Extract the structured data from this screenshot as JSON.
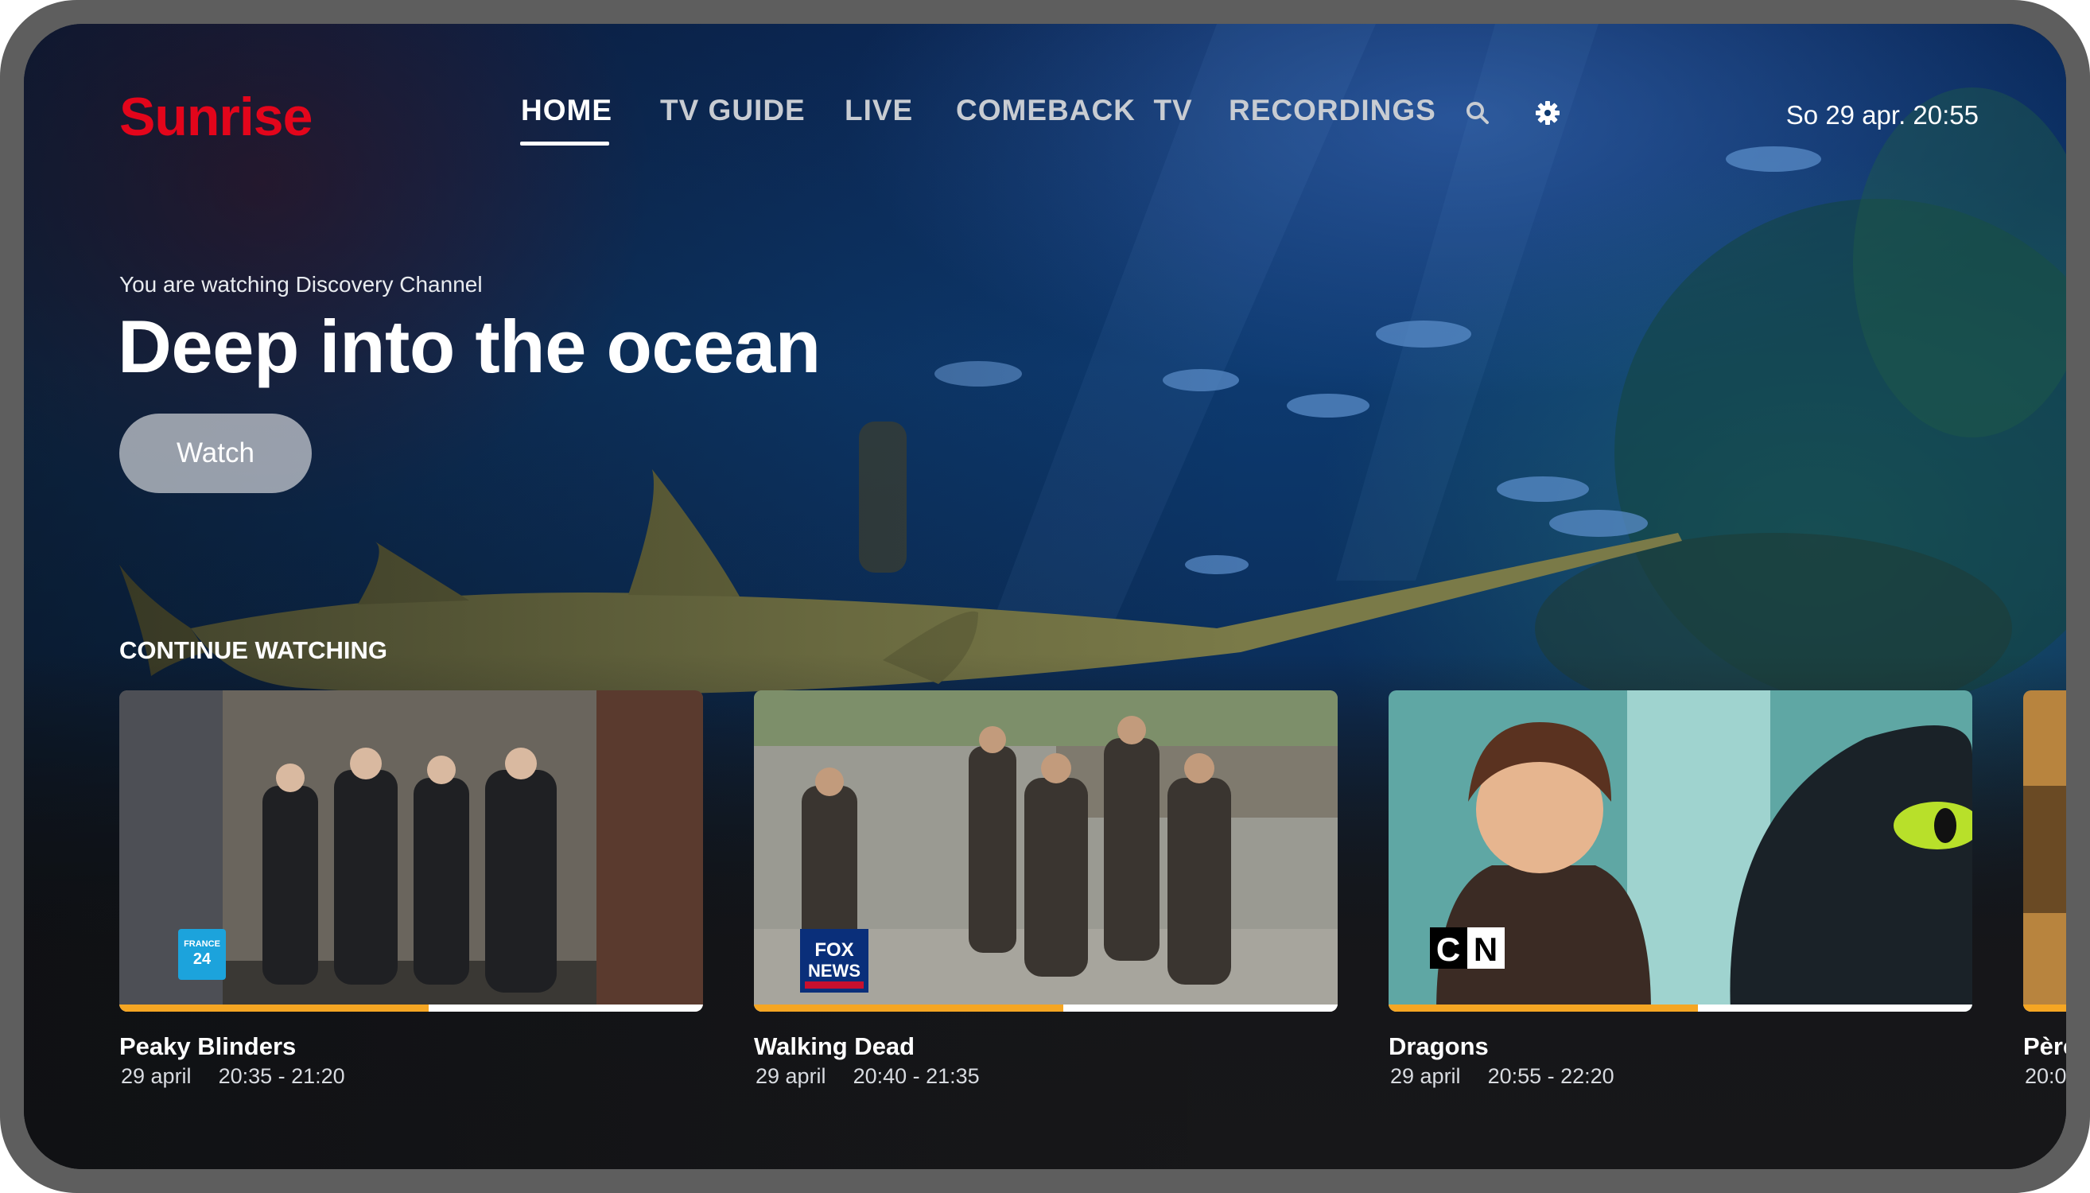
{
  "app": {
    "logo": "Sunrise",
    "brand_color": "#e3051b",
    "accent_color": "#f5a623"
  },
  "nav": {
    "items": [
      {
        "label": "HOME",
        "active": true
      },
      {
        "label": "TV GUIDE",
        "active": false
      },
      {
        "label": "LIVE",
        "active": false
      },
      {
        "label": "COMEBACK  TV",
        "active": false
      },
      {
        "label": "RECORDINGS",
        "active": false
      }
    ],
    "icons": [
      "search-icon",
      "gear-icon"
    ],
    "clock": "So 29 apr. 20:55"
  },
  "hero": {
    "eyebrow": "You are watching Discovery Channel",
    "title": "Deep into the ocean",
    "watch_label": "Watch"
  },
  "continue_watching": {
    "title": "CONTINUE WATCHING",
    "items": [
      {
        "title": "Peaky Blinders",
        "date": "29 april",
        "time": "20:35 - 21:20",
        "progress": 0.53,
        "channel_logo": "france24-logo"
      },
      {
        "title": "Walking Dead",
        "date": "29 april",
        "time": "20:40 - 21:35",
        "progress": 0.53,
        "channel_logo": "foxnews-logo",
        "channel_text": "FOX NEWS"
      },
      {
        "title": "Dragons",
        "date": "29 april",
        "time": "20:55 - 22:20",
        "progress": 0.53,
        "channel_logo": "cartoon-network-logo",
        "channel_text": "CN"
      },
      {
        "title": "Père",
        "date": "20:0",
        "time": "",
        "progress": 0.5
      }
    ]
  }
}
